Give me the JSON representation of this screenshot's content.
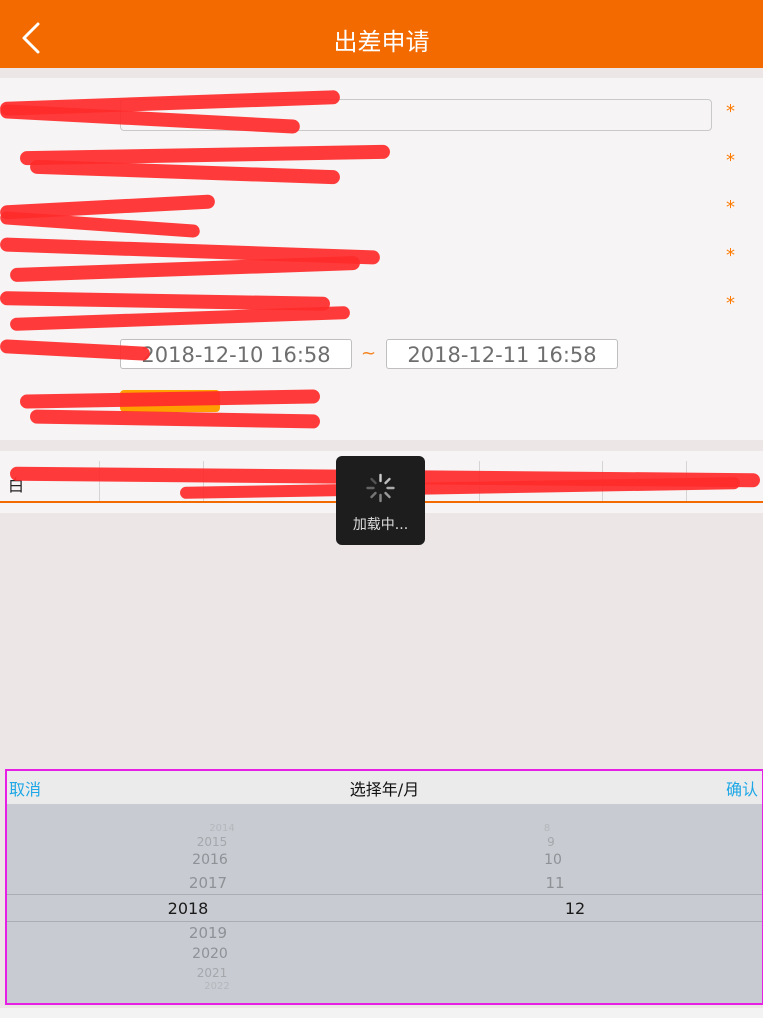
{
  "nav": {
    "title": "出差申请",
    "back_label": "<"
  },
  "form": {
    "required_mark": "*",
    "start_date": "2018-12-10 16:58",
    "end_date": "2018-12-11 16:58",
    "date_separator": "~"
  },
  "loading": {
    "text": "加载中..."
  },
  "picker": {
    "cancel": "取消",
    "title": "选择年/月",
    "confirm": "确认",
    "years": [
      "2014",
      "2015",
      "2016",
      "2017",
      "2018",
      "2019",
      "2020",
      "2021",
      "2022"
    ],
    "months": [
      "8",
      "9",
      "10",
      "11",
      "12"
    ],
    "selected_year": "2018",
    "selected_month": "12"
  },
  "colors": {
    "brand": "#f26a00",
    "accent_blue": "#1ea7e6",
    "required": "#ff7a00",
    "highlight_border": "#e51fe3"
  }
}
